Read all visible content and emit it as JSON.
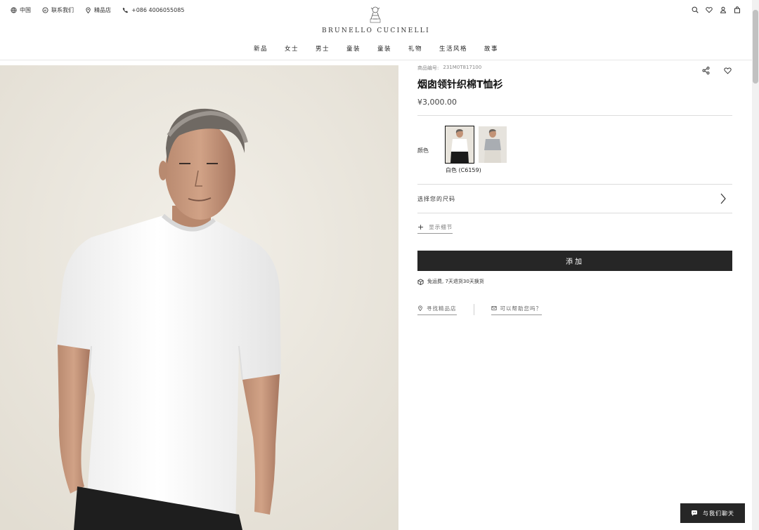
{
  "topbar": {
    "region_label": "中国",
    "contact_label": "联系我们",
    "stores_label": "精品店",
    "phone_label": "+086 4006055085"
  },
  "brand": {
    "name": "BRUNELLO CUCINELLI"
  },
  "nav": {
    "items": [
      "新品",
      "女士",
      "男士",
      "童装",
      "童装",
      "礼物",
      "生活风格",
      "故事"
    ]
  },
  "product": {
    "sku_label": "商品编号:",
    "sku_value": "231M0T817100",
    "title": "烟囱领针织棉T恤衫",
    "price": "¥3,000.00",
    "color_label": "颜色",
    "selected_color": "白色 (C6159)",
    "size_label": "选择您的尺码",
    "details_label": "显示细节",
    "add_label": "添加",
    "shipping_note": "免运费, 7天退货30天换货",
    "store_link": "寻找精品店",
    "help_link": "可以帮助您吗？"
  },
  "chat": {
    "label": "与我们聊天"
  },
  "colors": {
    "accent": "#262626",
    "divider": "#dcdcdc"
  }
}
